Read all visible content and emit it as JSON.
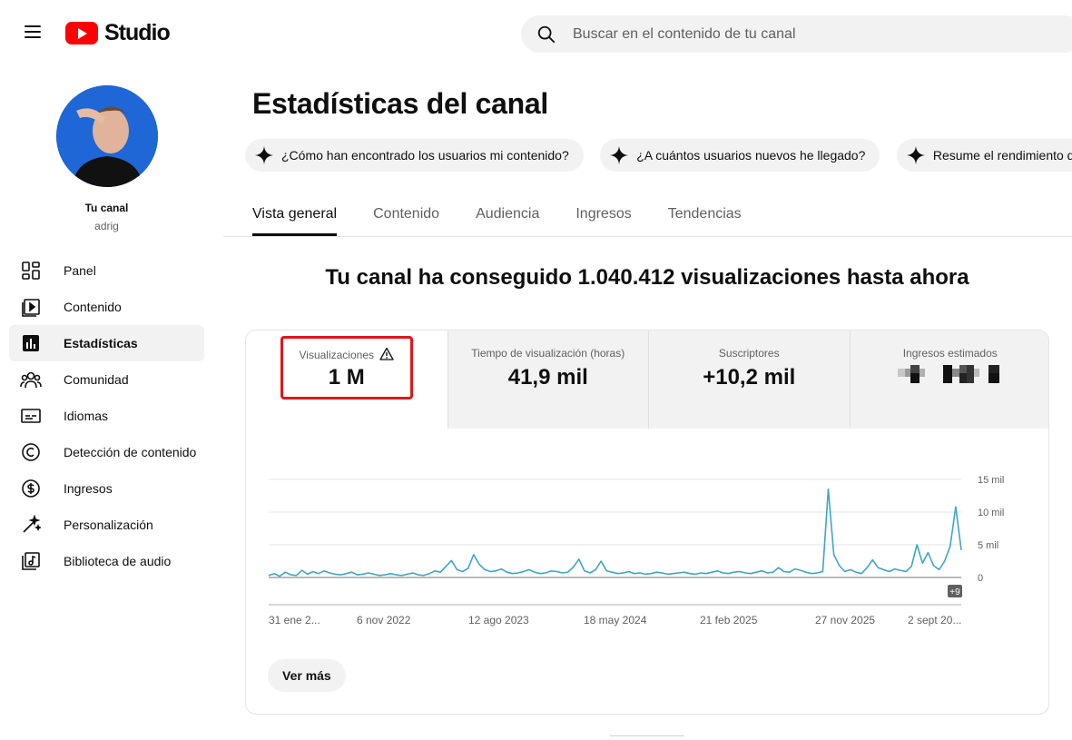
{
  "app": {
    "logo_text": "Studio"
  },
  "search": {
    "placeholder": "Buscar en el contenido de tu canal"
  },
  "channel": {
    "title": "Tu canal",
    "handle": "adrig"
  },
  "sidebar": {
    "items": [
      {
        "label": "Panel",
        "icon": "dashboard-icon"
      },
      {
        "label": "Contenido",
        "icon": "content-icon"
      },
      {
        "label": "Estadísticas",
        "icon": "analytics-icon",
        "active": true
      },
      {
        "label": "Comunidad",
        "icon": "community-icon"
      },
      {
        "label": "Idiomas",
        "icon": "subtitles-icon"
      },
      {
        "label": "Detección de contenido",
        "icon": "copyright-icon"
      },
      {
        "label": "Ingresos",
        "icon": "monetization-icon"
      },
      {
        "label": "Personalización",
        "icon": "customization-icon"
      },
      {
        "label": "Biblioteca de audio",
        "icon": "audio-library-icon"
      }
    ]
  },
  "page": {
    "title": "Estadísticas del canal"
  },
  "chips": [
    "¿Cómo han encontrado los usuarios mi contenido?",
    "¿A cuántos usuarios nuevos he llegado?",
    "Resume el rendimiento de"
  ],
  "tabs": [
    "Vista general",
    "Contenido",
    "Audiencia",
    "Ingresos",
    "Tendencias"
  ],
  "headline": "Tu canal ha conseguido 1.040.412 visualizaciones hasta ahora",
  "metrics": [
    {
      "label": "Visualizaciones",
      "value": "1 M",
      "selected": true
    },
    {
      "label": "Tiempo de visualización (horas)",
      "value": "41,9 mil"
    },
    {
      "label": "Suscriptores",
      "value": "+10,2 mil"
    },
    {
      "label": "Ingresos estimados",
      "value": "",
      "obscured": true
    }
  ],
  "chart_data": {
    "type": "line",
    "x_tick_labels": [
      "31 ene 2...",
      "6 nov 2022",
      "12 ago 2023",
      "18 may 2024",
      "21 feb 2025",
      "27 nov 2025",
      "2 sept 20..."
    ],
    "y_tick_labels": [
      "15 mil",
      "10 mil",
      "5 mil",
      "0"
    ],
    "ylim": [
      0,
      15000
    ],
    "grid": true,
    "color": "#3ea6c5",
    "series": [
      {
        "values": [
          300,
          600,
          200,
          800,
          400,
          300,
          1100,
          500,
          900,
          600,
          1000,
          700,
          500,
          400,
          600,
          800,
          400,
          500,
          700,
          500,
          300,
          400,
          600,
          400,
          300,
          500,
          700,
          400,
          300,
          600,
          1000,
          800,
          1700,
          2600,
          1200,
          900,
          1400,
          3500,
          2000,
          1200,
          900,
          1000,
          1300,
          800,
          600,
          700,
          900,
          1200,
          800,
          600,
          700,
          1000,
          900,
          700,
          800,
          1600,
          2800,
          1000,
          700,
          1200,
          2500,
          1000,
          800,
          600,
          700,
          900,
          600,
          700,
          500,
          600,
          800,
          700,
          500,
          600,
          700,
          800,
          600,
          500,
          700,
          600,
          800,
          1000,
          700,
          600,
          800,
          900,
          700,
          600,
          800,
          1000,
          700,
          800,
          1500,
          900,
          800,
          1300,
          1100,
          800,
          600,
          700,
          900,
          13500,
          3500,
          1800,
          900,
          1200,
          800,
          600,
          1500,
          2700,
          1500,
          1200,
          900,
          1300,
          1100,
          900,
          1700,
          5000,
          2200,
          3800,
          1800,
          1200,
          2500,
          4800,
          10800,
          4200
        ]
      }
    ]
  },
  "chart_badge": "+9",
  "see_more_label": "Ver más",
  "colors": {
    "accent": "#3ea6c5",
    "highlight": "#e0161b",
    "brand": "#ff0000"
  }
}
